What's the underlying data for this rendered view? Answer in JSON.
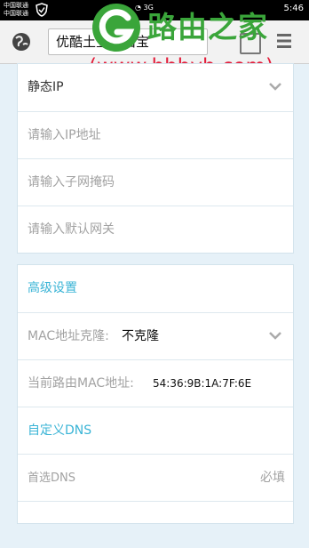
{
  "status_bar": {
    "carrier_1": "中国联通",
    "carrier_2": "中国联通",
    "network": "3G",
    "time": "5:46"
  },
  "browser": {
    "url_text": "优酷土豆路由宝"
  },
  "watermark": {
    "brand": "路由之家",
    "url": "(www.hhhyh.com)"
  },
  "network": {
    "mode_value": "静态IP",
    "ip_placeholder": "请输入IP地址",
    "mask_placeholder": "请输入子网掩码",
    "gateway_placeholder": "请输入默认网关"
  },
  "advanced": {
    "title": "高级设置",
    "mac_clone_label": "MAC地址克隆:",
    "mac_clone_value": "不克隆",
    "current_mac_label": "当前路由MAC地址:",
    "current_mac_value": "54:36:9B:1A:7F:6E",
    "dns_title": "自定义DNS",
    "primary_dns_label": "首选DNS",
    "primary_dns_hint": "必填"
  },
  "colors": {
    "accent": "#3ab4d6",
    "watermark_green": "#3aa53a",
    "watermark_red": "#e31d3a"
  }
}
